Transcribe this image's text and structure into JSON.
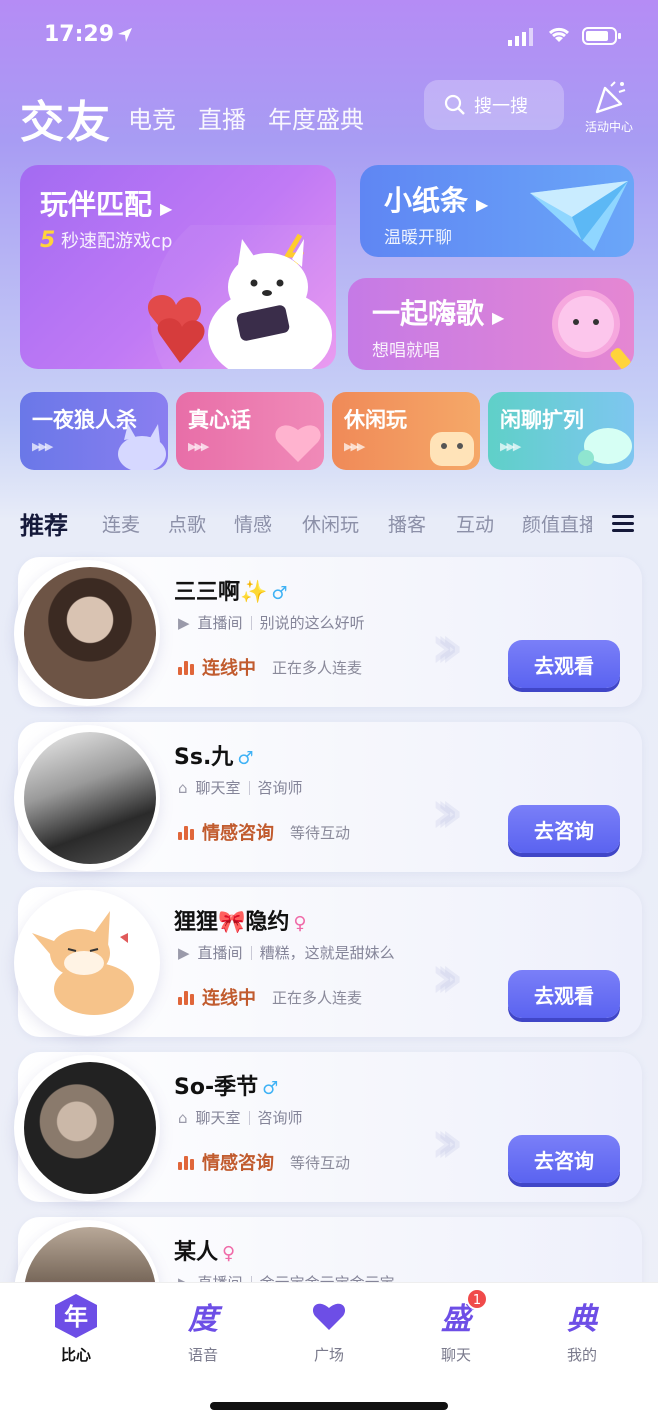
{
  "status_bar": {
    "time": "17:29"
  },
  "header": {
    "brand": "交友",
    "tabs": [
      "电竞",
      "直播",
      "年度盛典"
    ],
    "search_placeholder": "搜一搜",
    "activity_label": "活动中心"
  },
  "features": {
    "match": {
      "title": "玩伴匹配",
      "highlight": "5",
      "sub": "秒速配游戏cp"
    },
    "note": {
      "title": "小纸条",
      "sub": "温暖开聊"
    },
    "sing": {
      "title": "一起嗨歌",
      "sub": "想唱就唱"
    },
    "minis": [
      "一夜狼人杀",
      "真心话",
      "休闲玩",
      "闲聊扩列"
    ]
  },
  "categories": {
    "active": "推荐",
    "items": [
      "连麦",
      "点歌",
      "情感",
      "休闲玩",
      "播客",
      "互动",
      "颜值直播"
    ]
  },
  "list": [
    {
      "name": "三三啊✨",
      "gender": "♂",
      "room_type": "直播间",
      "desc": "别说的这么好听",
      "status": "连线中",
      "status_sub": "正在多人连麦",
      "action": "去观看"
    },
    {
      "name": "Ss.九",
      "gender": "♂",
      "room_type": "聊天室",
      "desc": "咨询师",
      "status": "情感咨询",
      "status_sub": "等待互动",
      "action": "去咨询"
    },
    {
      "name": "狸狸🎀隐约",
      "gender": "♀",
      "room_type": "直播间",
      "desc": "糟糕，这就是甜妹么",
      "status": "连线中",
      "status_sub": "正在多人连麦",
      "action": "去观看"
    },
    {
      "name": "So-季节",
      "gender": "♂",
      "room_type": "聊天室",
      "desc": "咨询师",
      "status": "情感咨询",
      "status_sub": "等待互动",
      "action": "去咨询"
    },
    {
      "name": "某人",
      "gender": "♀",
      "room_type": "直播间",
      "desc": "金元宝金元宝金元宝"
    }
  ],
  "bottom_nav": [
    {
      "glyph": "年",
      "label": "比心"
    },
    {
      "glyph": "度",
      "label": "语音"
    },
    {
      "glyph": "heart-icon",
      "label": "广场"
    },
    {
      "glyph": "盛",
      "label": "聊天",
      "badge": "1"
    },
    {
      "glyph": "典",
      "label": "我的"
    }
  ],
  "colors": {
    "accent": "#5a63f0",
    "status_orange": "#c15b2e",
    "male": "#3fb2f5",
    "female": "#f06aa8"
  }
}
